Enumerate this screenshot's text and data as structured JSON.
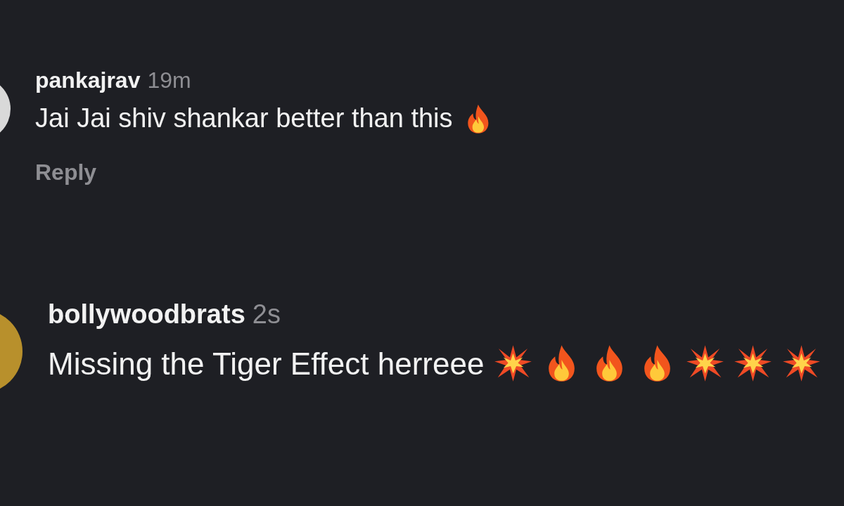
{
  "comments": [
    {
      "username": "pankajrav",
      "time": "19m",
      "text": "Jai Jai shiv shankar better than this",
      "emojis": [
        {
          "kind": "fire"
        }
      ],
      "reply": "Reply"
    },
    {
      "username": "bollywoodbrats",
      "time": "2s",
      "text": "Missing the Tiger Effect herreee",
      "emojis": [
        {
          "kind": "collision"
        },
        {
          "kind": "fire"
        },
        {
          "kind": "fire"
        },
        {
          "kind": "fire"
        },
        {
          "kind": "collision"
        },
        {
          "kind": "collision"
        },
        {
          "kind": "collision"
        }
      ]
    }
  ]
}
